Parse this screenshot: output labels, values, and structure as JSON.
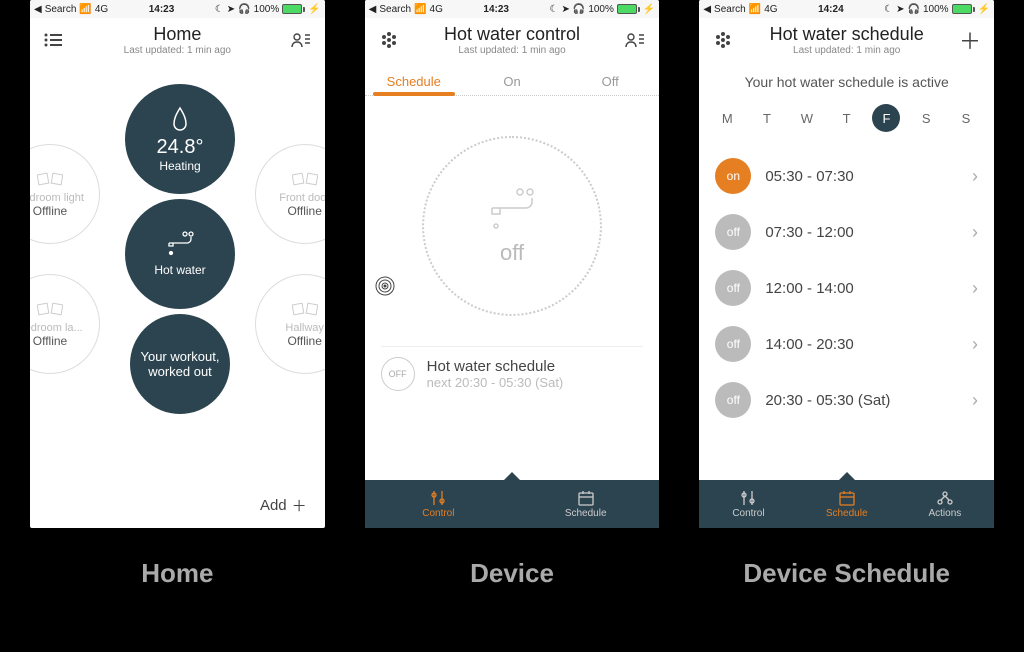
{
  "status": {
    "back": "Search",
    "net": "4G",
    "time1": "14:23",
    "time2": "14:23",
    "time3": "14:24",
    "pct": "100%"
  },
  "s1": {
    "title": "Home",
    "sub": "Last updated: 1 min ago",
    "heating": {
      "temp": "24.8°",
      "label": "Heating"
    },
    "hotwater": {
      "label": "Hot water"
    },
    "workout": {
      "l1": "Your workout,",
      "l2": "worked out"
    },
    "tiles": [
      {
        "name": "Bedroom light",
        "state": "Offline"
      },
      {
        "name": "Front door",
        "state": "Offline"
      },
      {
        "name": "Bedroom la...",
        "state": "Offline"
      },
      {
        "name": "Hallway",
        "state": "Offline"
      }
    ],
    "add": "Add"
  },
  "s2": {
    "title": "Hot water control",
    "sub": "Last updated: 1 min ago",
    "tabs": [
      "Schedule",
      "On",
      "Off"
    ],
    "dialstate": "off",
    "card": {
      "badge": "OFF",
      "title": "Hot water schedule",
      "sub": "next 20:30 - 05:30 (Sat)"
    },
    "nav": [
      "Control",
      "Schedule"
    ]
  },
  "s3": {
    "title": "Hot water schedule",
    "sub": "Last updated: 1 min ago",
    "status": "Your hot water schedule is active",
    "days": [
      "M",
      "T",
      "W",
      "T",
      "F",
      "S",
      "S"
    ],
    "activeDay": 4,
    "slots": [
      {
        "state": "on",
        "time": "05:30 - 07:30"
      },
      {
        "state": "off",
        "time": "07:30 - 12:00"
      },
      {
        "state": "off",
        "time": "12:00 - 14:00"
      },
      {
        "state": "off",
        "time": "14:00 - 20:30"
      },
      {
        "state": "off",
        "time": "20:30 - 05:30 (Sat)"
      }
    ],
    "nav": [
      "Control",
      "Schedule",
      "Actions"
    ]
  },
  "captions": [
    "Home",
    "Device",
    "Device Schedule"
  ]
}
